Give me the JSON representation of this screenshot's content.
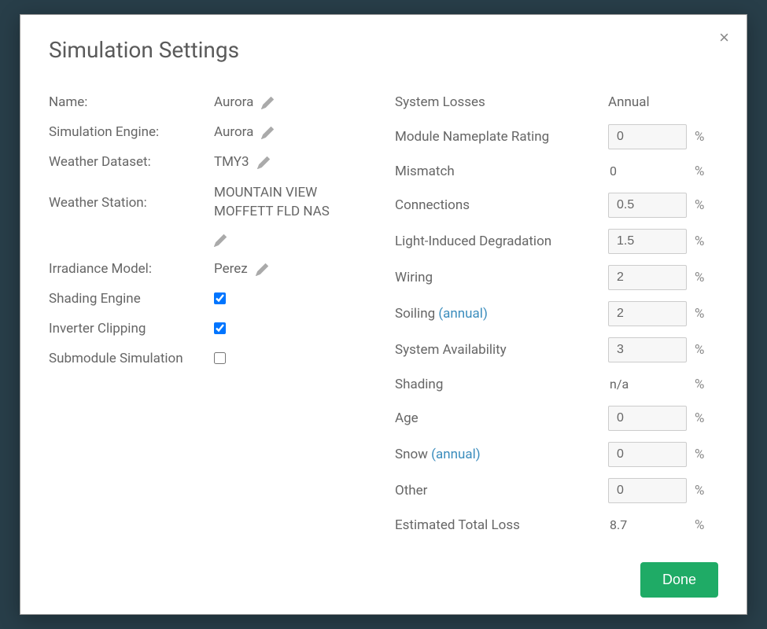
{
  "modal": {
    "title": "Simulation Settings",
    "close_label": "×",
    "done_label": "Done"
  },
  "settings": {
    "name": {
      "label": "Name:",
      "value": "Aurora"
    },
    "engine": {
      "label": "Simulation Engine:",
      "value": "Aurora"
    },
    "dataset": {
      "label": "Weather Dataset:",
      "value": "TMY3"
    },
    "station": {
      "label": "Weather Station:",
      "value": "MOUNTAIN VIEW MOFFETT FLD NAS"
    },
    "irradiance": {
      "label": "Irradiance Model:",
      "value": "Perez"
    },
    "shading_engine": {
      "label": "Shading Engine",
      "checked": true
    },
    "inverter_clipping": {
      "label": "Inverter Clipping",
      "checked": true
    },
    "submodule": {
      "label": "Submodule Simulation",
      "checked": false
    }
  },
  "losses": {
    "header": {
      "label": "System Losses",
      "annual": "Annual"
    },
    "unit": "%",
    "annual_link": "(annual)",
    "nameplate": {
      "label": "Module Nameplate Rating",
      "value": "0"
    },
    "mismatch": {
      "label": "Mismatch",
      "value": "0"
    },
    "connections": {
      "label": "Connections",
      "value": "0.5"
    },
    "lid": {
      "label": "Light-Induced Degradation",
      "value": "1.5"
    },
    "wiring": {
      "label": "Wiring",
      "value": "2"
    },
    "soiling": {
      "label": "Soiling ",
      "value": "2"
    },
    "availability": {
      "label": "System Availability",
      "value": "3"
    },
    "shading": {
      "label": "Shading",
      "value": "n/a"
    },
    "age": {
      "label": "Age",
      "value": "0"
    },
    "snow": {
      "label": "Snow ",
      "value": "0"
    },
    "other": {
      "label": "Other",
      "value": "0"
    },
    "total": {
      "label": "Estimated Total Loss",
      "value": "8.7"
    }
  }
}
